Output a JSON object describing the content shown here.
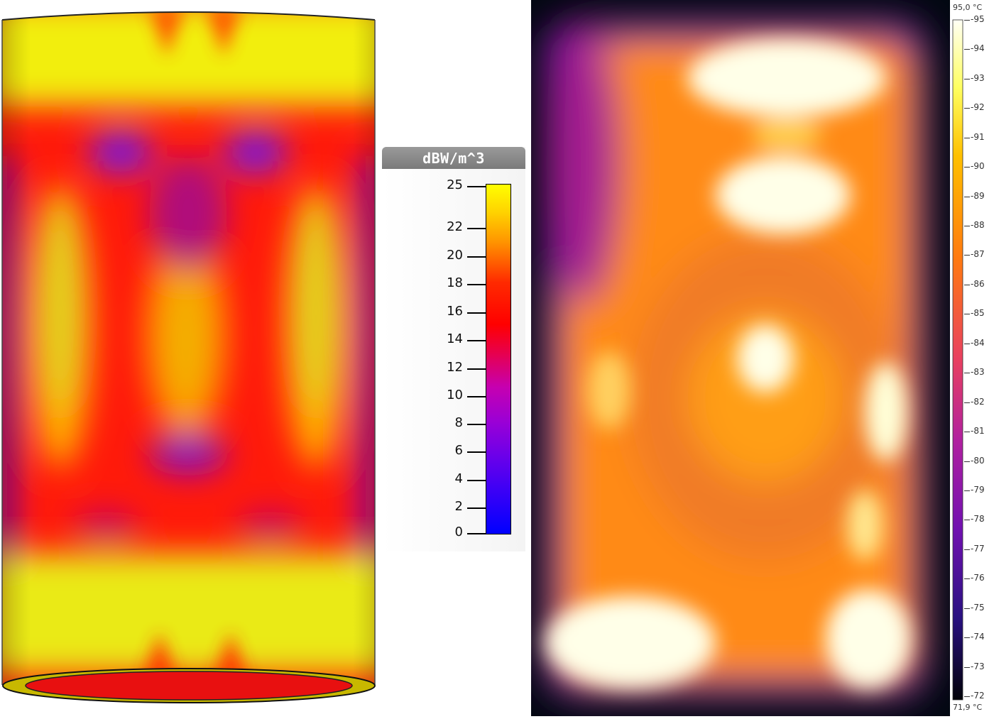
{
  "simulation": {
    "legend": {
      "unit": "dBW/m^3",
      "ticks": [
        "25",
        "22",
        "20",
        "18",
        "16",
        "14",
        "12",
        "10",
        "8",
        "6",
        "4",
        "2",
        "0"
      ],
      "colors": {
        "max": "#ffff00",
        "mid": "#ff0000",
        "min": "#0000ff"
      }
    }
  },
  "thermal": {
    "scale": {
      "max_label": "95,0 °C",
      "min_label": "71,9 °C",
      "ticks": [
        "95",
        "94",
        "93",
        "92",
        "91",
        "90",
        "89",
        "88",
        "87",
        "86",
        "85",
        "84",
        "83",
        "82",
        "81",
        "80",
        "79",
        "78",
        "77",
        "76",
        "75",
        "74",
        "73",
        "72"
      ]
    }
  }
}
